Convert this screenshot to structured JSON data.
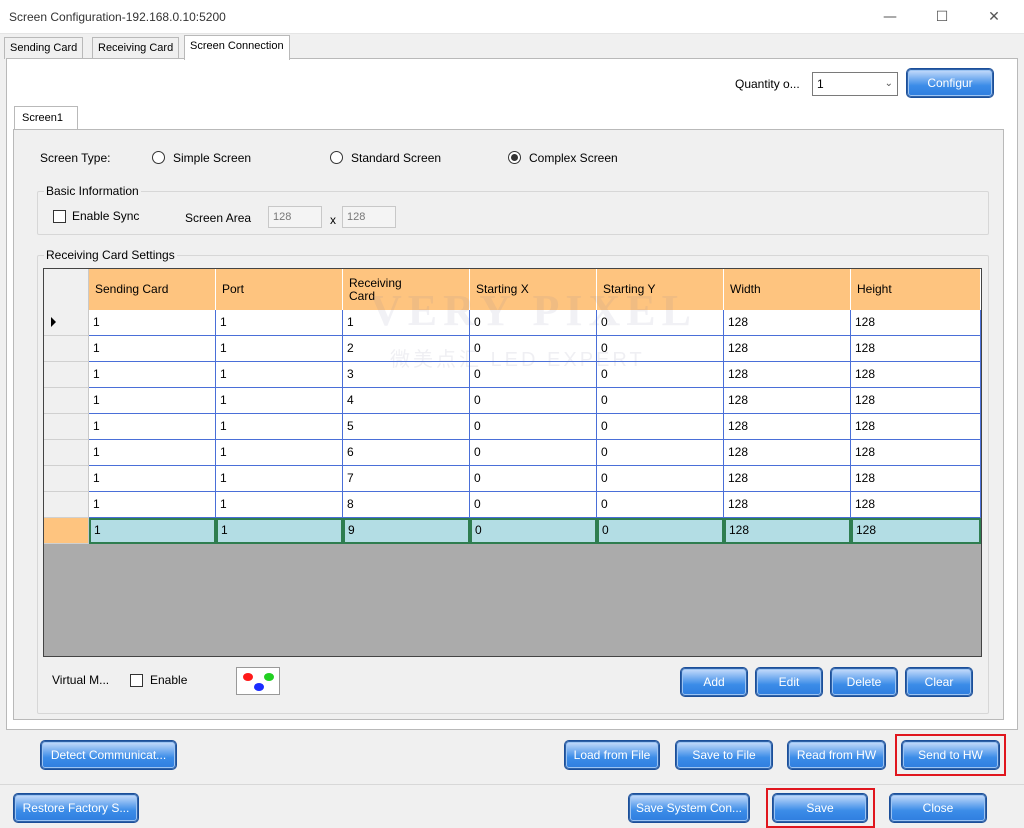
{
  "window": {
    "title": "Screen Configuration-192.168.0.10:5200",
    "minimize": "—",
    "maximize": "☐",
    "close": "✕"
  },
  "tabs": [
    {
      "label": "Sending Card"
    },
    {
      "label": "Receiving Card"
    },
    {
      "label": "Screen Connection",
      "active": true
    }
  ],
  "quantity": {
    "label": "Quantity o...",
    "value": "1",
    "configure_label": "Configur"
  },
  "screen_tab": {
    "label": "Screen1"
  },
  "screen_type": {
    "label": "Screen Type:",
    "options": [
      {
        "label": "Simple Screen",
        "checked": false
      },
      {
        "label": "Standard Screen",
        "checked": false
      },
      {
        "label": "Complex Screen",
        "checked": true
      }
    ]
  },
  "basic_info": {
    "title": "Basic Information",
    "enable_sync_label": "Enable Sync",
    "enable_sync_checked": false,
    "screen_area_label": "Screen Area",
    "width": "128",
    "x_label": "x",
    "height": "128"
  },
  "receiving_settings": {
    "title": "Receiving Card Settings",
    "columns": [
      "Sending Card",
      "Port",
      "Receiving\nCard",
      "Starting X",
      "Starting Y",
      "Width",
      "Height"
    ],
    "rows": [
      [
        "1",
        "1",
        "1",
        "0",
        "0",
        "128",
        "128"
      ],
      [
        "1",
        "1",
        "2",
        "0",
        "0",
        "128",
        "128"
      ],
      [
        "1",
        "1",
        "3",
        "0",
        "0",
        "128",
        "128"
      ],
      [
        "1",
        "1",
        "4",
        "0",
        "0",
        "128",
        "128"
      ],
      [
        "1",
        "1",
        "5",
        "0",
        "0",
        "128",
        "128"
      ],
      [
        "1",
        "1",
        "6",
        "0",
        "0",
        "128",
        "128"
      ],
      [
        "1",
        "1",
        "7",
        "0",
        "0",
        "128",
        "128"
      ],
      [
        "1",
        "1",
        "8",
        "0",
        "0",
        "128",
        "128"
      ],
      [
        "1",
        "1",
        "9",
        "0",
        "0",
        "128",
        "128"
      ]
    ],
    "current_row": 0,
    "selected_row": 8
  },
  "watermark": {
    "line1": "VERY PIXEL",
    "line2": "微美点汇 LED EXPERT"
  },
  "virtual": {
    "label": "Virtual M...",
    "enable_label": "Enable",
    "enable_checked": false,
    "palette_colors": [
      "#ff1a1a",
      "#22d022",
      "#1a2cff"
    ]
  },
  "grid_buttons": {
    "add": "Add",
    "edit": "Edit",
    "delete": "Delete",
    "clear": "Clear"
  },
  "actions": {
    "detect": "Detect Communicat...",
    "load_from_file": "Load from File",
    "save_to_file": "Save to File",
    "read_from_hw": "Read from HW",
    "send_to_hw": "Send to HW"
  },
  "footer": {
    "restore": "Restore Factory S...",
    "save_system": "Save System Con...",
    "save": "Save",
    "close": "Close"
  },
  "colors": {
    "header_orange": "#fec47f",
    "selected_row": "#b3dde4",
    "button_blue": "#3b8ce8",
    "highlight_red": "#e0161e"
  }
}
